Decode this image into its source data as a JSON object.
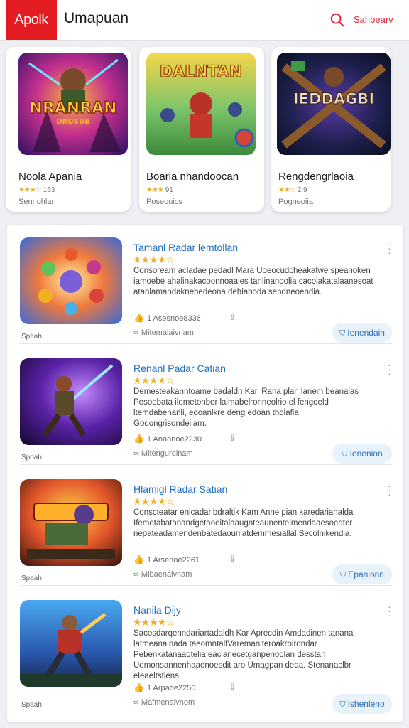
{
  "header": {
    "logo": "Apolk",
    "title": "Umapuan",
    "search_label": "Sahbearv"
  },
  "featured": [
    {
      "name": "Noola Apania",
      "rating": "163",
      "sub": "Sennohlan",
      "art_text": "NRANRAN",
      "art_sub": "DROSUB"
    },
    {
      "name": "Boaria nhandoocan",
      "rating": "91",
      "sub": "Poseouics",
      "art_text": "DALNTAN",
      "art_sub": ""
    },
    {
      "name": "Rengdengrlaoia",
      "rating": "2.9",
      "sub": "Pogneoiia",
      "art_text": "IEDDAGBI",
      "art_sub": ""
    }
  ],
  "list": [
    {
      "title": "Tamanl Radar lemtollan",
      "description": "Consoream acladae pedadl Mara Uoeocudcheakatwe speanoken iamoebe ahalinakacoonnoaaies tanlinanoolia cacolakatalaanesoat atanlamandaknehedeona dehiaboda sendneoendia.",
      "downloads": "1 Asesnoe8336",
      "dev": "Mitemaiaivnam",
      "caption": "Spaah",
      "button": "Ienendain"
    },
    {
      "title": "Renanl Padar Catian",
      "description": "Demesteakanntoame badaldn Kar. Rana plan lanem beanalas Pesoebata ilemetonber laimabelronneolrio el fengoeld ltemdabenanli, eooanlkre deng edoan tholafia. Godongrisondeiiam.",
      "downloads": "1 Anaonoe2230",
      "dev": "Mitengurdinam",
      "caption": "Spoah",
      "button": "Ienenion"
    },
    {
      "title": "Hlamigl Radar Satian",
      "description": "Conscteatar enlcadaribdraltik Kam Anne pian karedarianalda Ifemotabatanandgetaoeitalaaugnteaunentelmendaaesoedter nepateadamendenbatedaouniatdemmesiallal Secolnikendia.",
      "downloads": "1 Arsenoe2261",
      "dev": "Mibaenaivnam",
      "caption": "Spaah",
      "button": "Epanlonn"
    },
    {
      "title": "Nanila Dijy",
      "description": "Sacosdarqenndariartadaldh Kar Aprecdin Amdadinen tanana latmeanalnada taeomntalfVaremanlteroakroirondar Pebenkatanaaotelia eacianecetganpenoolan desstan Uemonsannenhaaenoesdit aro Umagpan deda. Stenanaclbr eleaeltstiens.",
      "downloads": "1 Arpaoe2250",
      "dev": "Mafmenaivnom",
      "caption": "Spaah",
      "button": "Ishenleno"
    }
  ]
}
